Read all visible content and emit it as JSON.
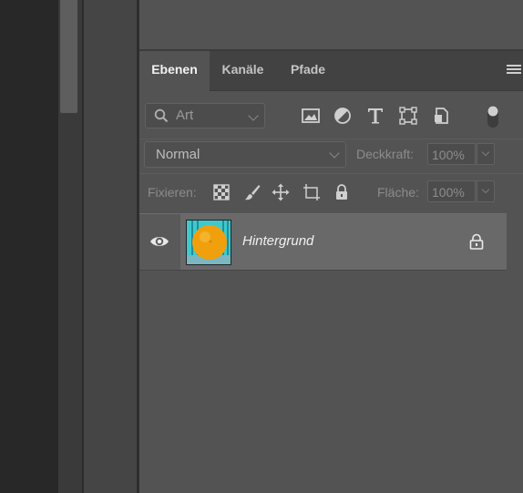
{
  "tabs": [
    {
      "label": "Ebenen",
      "active": true
    },
    {
      "label": "Kanäle",
      "active": false
    },
    {
      "label": "Pfade",
      "active": false
    }
  ],
  "filter": {
    "kind_label": "Art",
    "icons": [
      "image-filter-icon",
      "adjustment-filter-icon",
      "type-filter-icon",
      "shape-filter-icon",
      "smart-object-filter-icon",
      "filter-toggle-icon"
    ]
  },
  "blend": {
    "mode": "Normal",
    "opacity_label": "Deckkraft:",
    "opacity_value": "100%"
  },
  "lock_row": {
    "label": "Fixieren:",
    "icons": [
      "lock-transparent-pixels-icon",
      "lock-image-pixels-icon",
      "lock-position-icon",
      "lock-artboard-icon",
      "lock-all-icon"
    ],
    "fill_label": "Fläche:",
    "fill_value": "100%"
  },
  "layers": [
    {
      "name": "Hintergrund",
      "visible": true,
      "locked": true,
      "selected": true
    }
  ],
  "colors": {
    "panel_bg": "#535353",
    "tab_bar_bg": "#424242",
    "selected_layer_bg": "#696969",
    "thumbnail_bg": "#3fc9cf",
    "orange": "#f0a00d"
  }
}
